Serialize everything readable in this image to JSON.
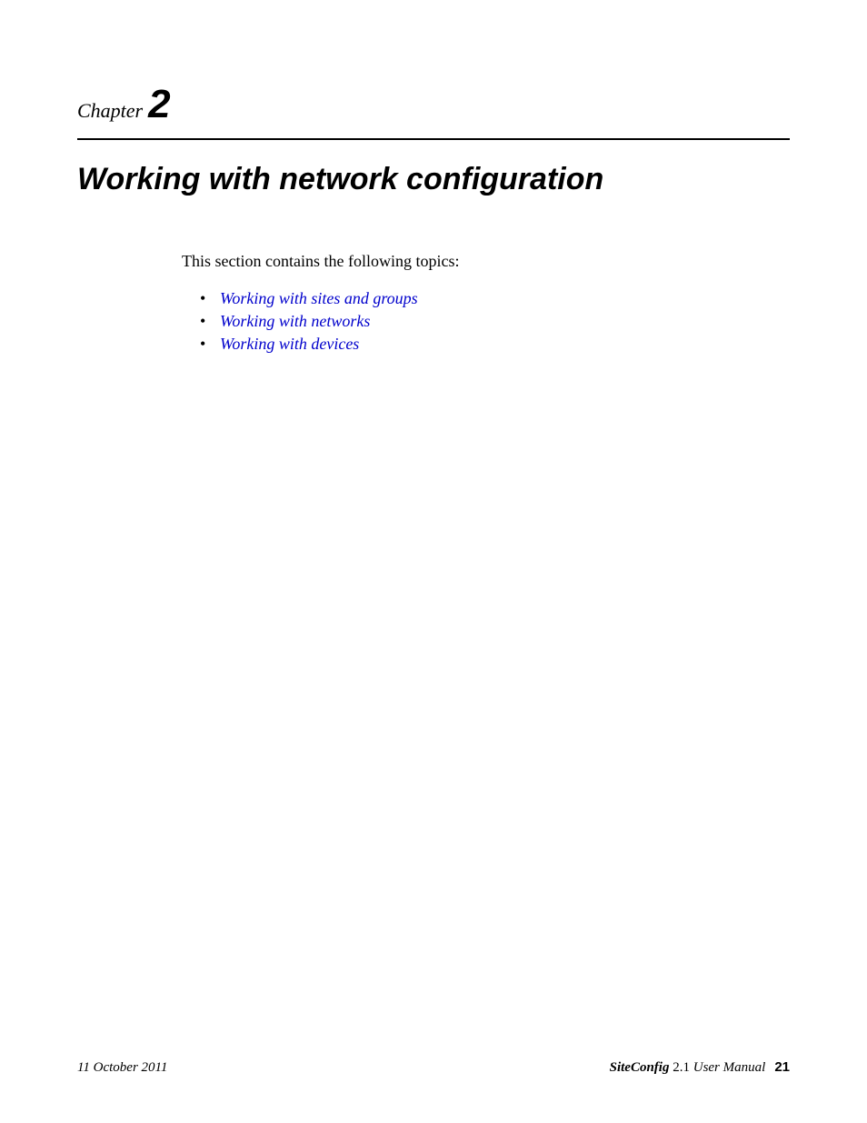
{
  "chapter": {
    "label": "Chapter",
    "number": "2"
  },
  "title": "Working with network configuration",
  "intro": "This section contains the following topics:",
  "topics": [
    "Working with sites and groups",
    "Working with networks",
    "Working with devices"
  ],
  "footer": {
    "date": "11 October 2011",
    "product": "SiteConfig",
    "version": "2.1",
    "manual_label": "User Manual",
    "page_number": "21"
  }
}
